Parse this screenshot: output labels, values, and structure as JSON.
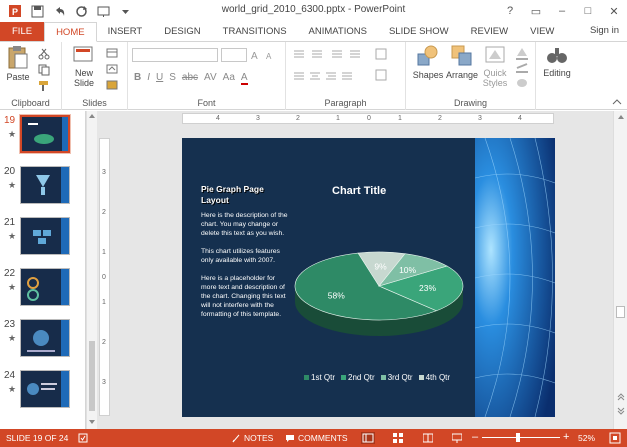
{
  "window": {
    "title": "world_grid_2010_6300.pptx - PowerPoint",
    "controls": [
      "?",
      "▭",
      "–",
      "□",
      "✕"
    ]
  },
  "ribbon_tabs": [
    "FILE",
    "HOME",
    "INSERT",
    "DESIGN",
    "TRANSITIONS",
    "ANIMATIONS",
    "SLIDE SHOW",
    "REVIEW",
    "VIEW"
  ],
  "active_tab": "HOME",
  "signin": "Sign in",
  "groups": {
    "clipboard": {
      "label": "Clipboard",
      "paste": "Paste"
    },
    "slides": {
      "label": "Slides",
      "new_slide_line1": "New",
      "new_slide_line2": "Slide"
    },
    "font": {
      "label": "Font"
    },
    "paragraph": {
      "label": "Paragraph"
    },
    "drawing": {
      "label": "Drawing",
      "shapes": "Shapes",
      "arrange": "Arrange",
      "quick_styles_line1": "Quick",
      "quick_styles_line2": "Styles"
    },
    "editing": {
      "label": "Editing",
      "editing": "Editing"
    }
  },
  "font_buttons": [
    "B",
    "I",
    "U",
    "S",
    "abc",
    "AV",
    "Aa",
    "A"
  ],
  "thumbnails": [
    {
      "num": "19",
      "selected": true
    },
    {
      "num": "20",
      "selected": false
    },
    {
      "num": "21",
      "selected": false
    },
    {
      "num": "22",
      "selected": false
    },
    {
      "num": "23",
      "selected": false
    },
    {
      "num": "24",
      "selected": false
    }
  ],
  "thumb_star": "★",
  "ruler": {
    "h_ticks": [
      "4",
      "3",
      "2",
      "1",
      "0",
      "1",
      "2",
      "3",
      "4"
    ],
    "v_ticks": [
      "3",
      "2",
      "1",
      "0",
      "1",
      "2",
      "3"
    ]
  },
  "slide": {
    "title": "Pie Graph Page Layout",
    "desc1": "Here is the description of the chart.  You may change or delete this text as you wish.",
    "desc2": "This chart utilizes features only available with  2007.",
    "desc3": "Here is a placeholder for more text and description of the chart.  Changing this text will not interfere with the formatting of this template."
  },
  "chart_data": {
    "type": "pie",
    "title": "Chart Title",
    "categories": [
      "1st Qtr",
      "2nd Qtr",
      "3rd Qtr",
      "4th Qtr"
    ],
    "values": [
      58,
      23,
      10,
      9
    ],
    "labels": [
      "58%",
      "23%",
      "10%",
      "9%"
    ],
    "colors": [
      "#2e8a66",
      "#3aa57a",
      "#7fbfa5",
      "#c7d8d0"
    ],
    "legend_position": "bottom"
  },
  "status": {
    "slide": "SLIDE 19 OF 24",
    "notes": "NOTES",
    "comments": "COMMENTS",
    "zoom": "52%"
  },
  "colors": {
    "accent": "#d24726",
    "slide_bg": "#15304f"
  }
}
